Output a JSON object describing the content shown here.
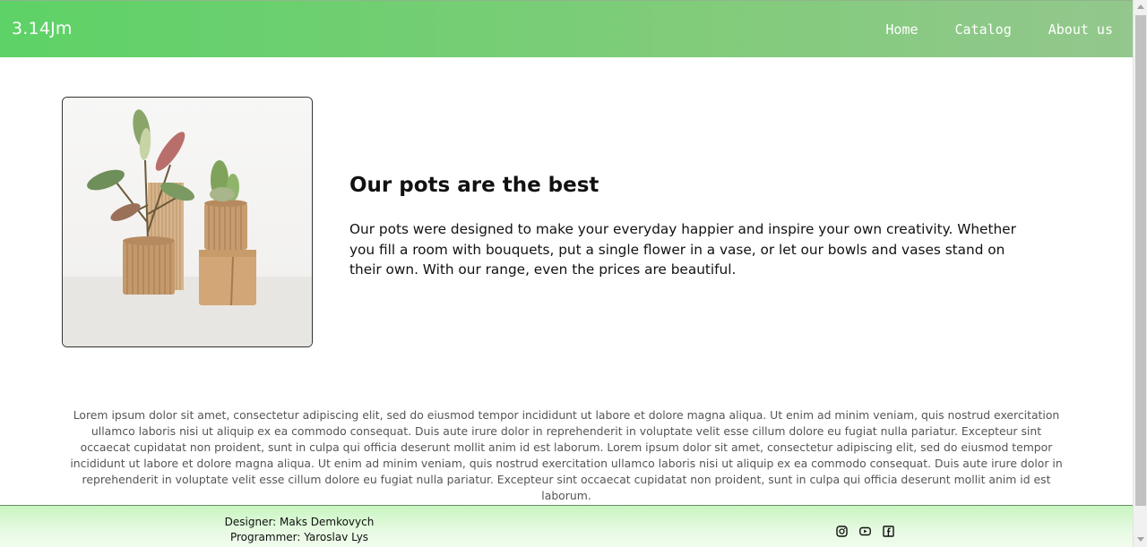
{
  "header": {
    "logo": "3.14Jm",
    "nav": [
      {
        "label": "Home"
      },
      {
        "label": "Catalog"
      },
      {
        "label": "About us"
      }
    ],
    "colors": {
      "gradient_start": "#5dd266",
      "gradient_end": "#93c78d"
    }
  },
  "hero": {
    "title": "Our pots are the best",
    "text": "Our pots were designed to make your everyday happier and inspire your own creativity. Whether you fill a room with bouquets, put a single flower in a vase, or let our bowls and vases stand on their own. With our range, even the prices are beautiful."
  },
  "lorem": "Lorem ipsum dolor sit amet, consectetur adipiscing elit, sed do eiusmod tempor incididunt ut labore et dolore magna aliqua. Ut enim ad minim veniam, quis nostrud exercitation ullamco laboris nisi ut aliquip ex ea commodo consequat. Duis aute irure dolor in reprehenderit in voluptate velit esse cillum dolore eu fugiat nulla pariatur. Excepteur sint occaecat cupidatat non proident, sunt in culpa qui officia deserunt mollit anim id est laborum. Lorem ipsum dolor sit amet, consectetur adipiscing elit, sed do eiusmod tempor incididunt ut labore et dolore magna aliqua. Ut enim ad minim veniam, quis nostrud exercitation ullamco laboris nisi ut aliquip ex ea commodo consequat. Duis aute irure dolor in reprehenderit in voluptate velit esse cillum dolore eu fugiat nulla pariatur. Excepteur sint occaecat cupidatat non proident, sunt in culpa qui officia deserunt mollit anim id est laborum.",
  "footer": {
    "designer": "Designer: Maks Demkovych",
    "programmer": "Programmer: Yaroslav Lys",
    "socials": [
      {
        "icon": "instagram-icon"
      },
      {
        "icon": "youtube-icon"
      },
      {
        "icon": "facebook-icon"
      }
    ]
  }
}
